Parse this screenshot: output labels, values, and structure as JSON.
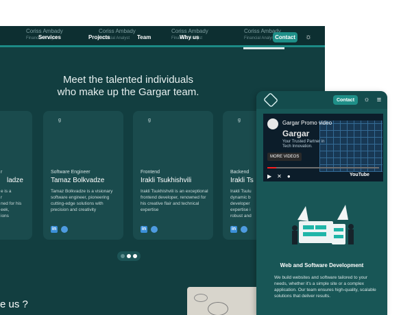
{
  "nav": {
    "ghost_names": [
      "Coriss Ambady",
      "Coriss Ambady",
      "Coriss Ambady",
      "Coriss Ambady"
    ],
    "ghost_subs": [
      "Financial Analyst",
      "Financial Analyst",
      "Financial Analyst",
      "Financial Analyst"
    ],
    "links": [
      "Services",
      "Projects",
      "Team",
      "Why us"
    ],
    "contact_label": "Contact"
  },
  "team": {
    "heading_line1": "Meet the talented individuals",
    "heading_line2": "who make up the Gargar team.",
    "cards": [
      {
        "img_alt": "g",
        "role": "r",
        "name": "ladze",
        "bio": "e is a\nr\nned for his\neek,\nions"
      },
      {
        "img_alt": "g",
        "role": "Software Engineer",
        "name": "Tamaz Bolkvadze",
        "bio": "Tamaz Bolkvadze is a visionary software engineer, pioneering cutting-edge solutions with precision and creativity"
      },
      {
        "img_alt": "g",
        "role": "Frontend",
        "name": "Irakli Tsukhishvili",
        "bio": "Irakli Tsukhishvili is an exceptional frontend developer, renowned for his creative flair and technical expertise"
      },
      {
        "img_alt": "g",
        "role": "Backend",
        "name": "Irakli Ts",
        "bio": "Irakli Tsulu\ndynamic b\ndeveloper\nexpertise i\nrobust and"
      }
    ]
  },
  "why_us": "e us ?",
  "mobile": {
    "contact_label": "Contact",
    "video": {
      "title": "Gargar Promo video",
      "brand": "Gargar",
      "tagline": "Your Trusted Partner in Tech Innovation.",
      "more_label": "MORE VIDEOS",
      "progress": 0.08,
      "youtube_label": "YouTube"
    },
    "service_title": "Web and Software Development",
    "service_desc": "We build websites and software tailored to your needs, whether it's a simple site or a complex application. Our team ensures high-quality, scalable solutions that deliver results."
  },
  "colors": {
    "background": "#123e40",
    "accent": "#1f8f88",
    "card": "#1a4b4d"
  }
}
